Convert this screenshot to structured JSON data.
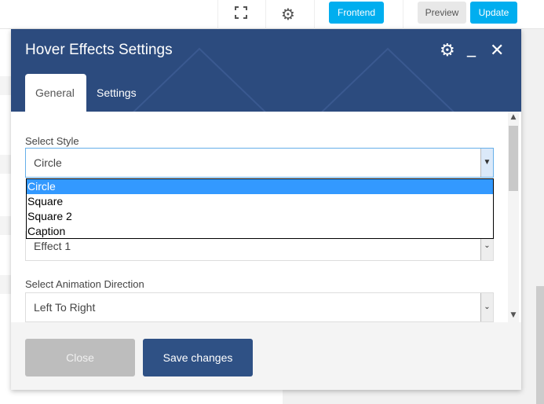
{
  "topbar": {
    "fullscreen_icon": "fullscreen-icon",
    "settings_icon": "gear-icon",
    "frontend_label": "Frontend",
    "preview_label": "Preview",
    "update_label": "Update",
    "accent": "#00aeef"
  },
  "modal": {
    "title": "Hover Effects Settings",
    "header_color": "#2c4b7e",
    "icons": {
      "settings": "gear-icon",
      "minimize": "minimize-icon",
      "close": "close-icon"
    },
    "tabs": [
      {
        "label": "General",
        "active": true
      },
      {
        "label": "Settings",
        "active": false
      }
    ],
    "fields": {
      "style": {
        "label": "Select Style",
        "value": "Circle",
        "options": [
          "Circle",
          "Square",
          "Square 2",
          "Caption"
        ]
      },
      "effect": {
        "value": "Effect 1"
      },
      "direction": {
        "label": "Select Animation Direction",
        "value": "Left To Right"
      }
    },
    "footer": {
      "close_label": "Close",
      "save_label": "Save changes"
    }
  }
}
